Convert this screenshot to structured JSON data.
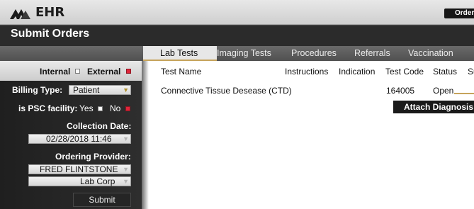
{
  "app": {
    "name": "EHR",
    "header_button": "Order"
  },
  "page": {
    "title": "Submit Orders"
  },
  "tabs": [
    {
      "label": "Lab Tests",
      "active": true
    },
    {
      "label": "Imaging Tests"
    },
    {
      "label": "Procedures"
    },
    {
      "label": "Referrals"
    },
    {
      "label": "Vaccination"
    }
  ],
  "left_panel": {
    "internal_label": "Internal",
    "internal_checked": false,
    "external_label": "External",
    "external_checked": true,
    "billing_type_label": "Billing Type:",
    "billing_type_value": "Patient",
    "psc_label": "is PSC facility:",
    "psc_yes_label": "Yes",
    "psc_yes_checked": false,
    "psc_no_label": "No",
    "psc_no_checked": true,
    "collection_date_label": "Collection Date:",
    "collection_date_value": "02/28/2018  11:46",
    "ordering_provider_label": "Ordering Provider:",
    "ordering_provider_value": "FRED FLINTSTONE",
    "lab_value": "Lab Corp",
    "submit_label": "Submit"
  },
  "table": {
    "columns": [
      "Test Name",
      "Instructions",
      "Indication",
      "Test Code",
      "Status",
      "Su"
    ],
    "rows": [
      {
        "test_name": "Connective Tissue Desease (CTD)",
        "instructions": "",
        "indication": "",
        "test_code": "164005",
        "status": "Open"
      }
    ],
    "attach_button": "Attach Diagnosis"
  },
  "colors": {
    "accent": "#c6a35b",
    "checked": "#e0253a",
    "dark_bar": "#2b2b2b"
  }
}
